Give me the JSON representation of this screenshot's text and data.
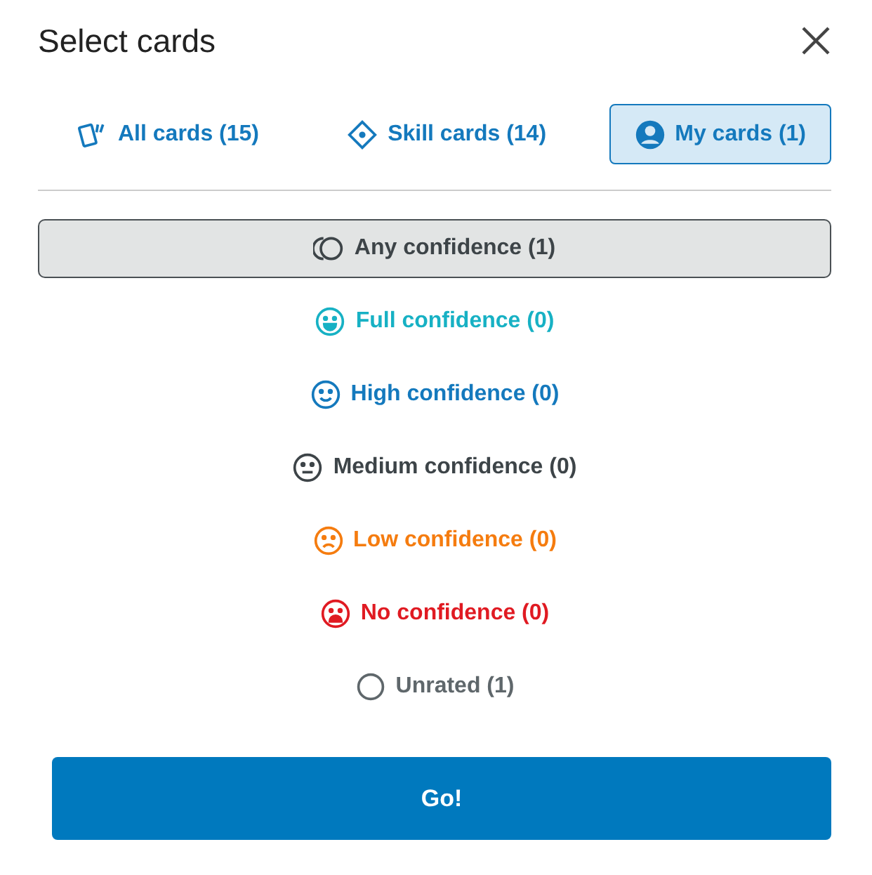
{
  "dialog": {
    "title": "Select cards"
  },
  "tabs": [
    {
      "label": "All cards (15)",
      "kind": "all",
      "selected": false
    },
    {
      "label": "Skill cards (14)",
      "kind": "skill",
      "selected": false
    },
    {
      "label": "My cards (1)",
      "kind": "mine",
      "selected": true
    }
  ],
  "confidence": [
    {
      "label": "Any confidence (1)",
      "kind": "any",
      "color": "#3d4448",
      "selected": true
    },
    {
      "label": "Full confidence (0)",
      "kind": "full",
      "color": "#17b1c4",
      "selected": false
    },
    {
      "label": "High confidence (0)",
      "kind": "high",
      "color": "#1479bd",
      "selected": false
    },
    {
      "label": "Medium confidence (0)",
      "kind": "medium",
      "color": "#3d4448",
      "selected": false
    },
    {
      "label": "Low confidence (0)",
      "kind": "low",
      "color": "#f57c0f",
      "selected": false
    },
    {
      "label": "No confidence (0)",
      "kind": "none",
      "color": "#e01a22",
      "selected": false
    },
    {
      "label": "Unrated (1)",
      "kind": "unrated",
      "color": "#5f676b",
      "selected": false
    }
  ],
  "go_button": {
    "label": "Go!"
  }
}
